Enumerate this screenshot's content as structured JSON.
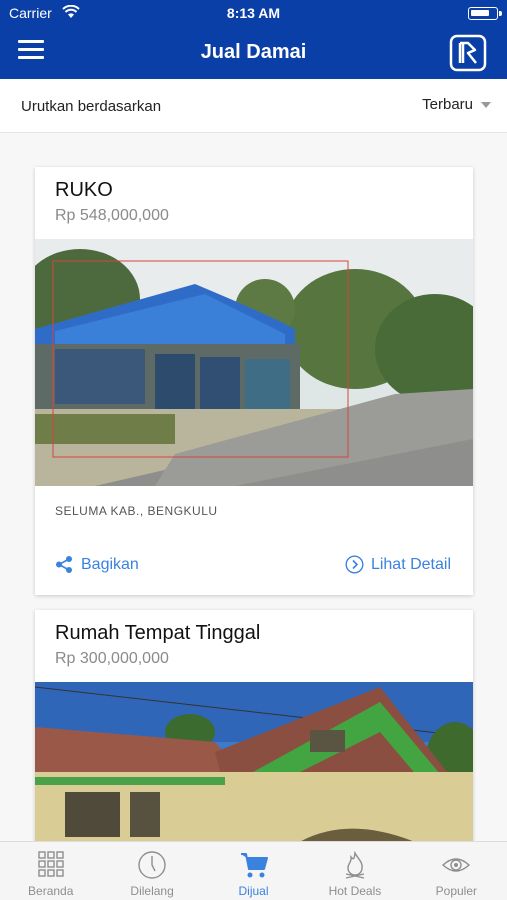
{
  "status_bar": {
    "carrier": "Carrier",
    "time": "8:13 AM"
  },
  "header": {
    "title": "Jual Damai",
    "menu_icon": "hamburger-icon",
    "logo_icon": "bri-logo"
  },
  "sort": {
    "label": "Urutkan berdasarkan",
    "selected": "Terbaru"
  },
  "listings": [
    {
      "title": "RUKO",
      "price": "Rp 548,000,000",
      "location": "SELUMA KAB., BENGKULU",
      "share_label": "Bagikan",
      "detail_label": "Lihat Detail",
      "photo": "blue-roof-shophouse-roadside"
    },
    {
      "title": "Rumah Tempat Tinggal",
      "price": "Rp 300,000,000",
      "photo": "tiled-roof-house-green-trim"
    }
  ],
  "tabs": [
    {
      "label": "Beranda",
      "icon": "grid-icon",
      "active": false
    },
    {
      "label": "Dilelang",
      "icon": "clock-icon",
      "active": false
    },
    {
      "label": "Dijual",
      "icon": "cart-icon",
      "active": true
    },
    {
      "label": "Hot Deals",
      "icon": "fire-icon",
      "active": false
    },
    {
      "label": "Populer",
      "icon": "eye-icon",
      "active": false
    }
  ],
  "colors": {
    "brand_blue": "#0b3fa8",
    "accent_blue": "#3b82e0",
    "muted_text": "#8a8a8a"
  }
}
